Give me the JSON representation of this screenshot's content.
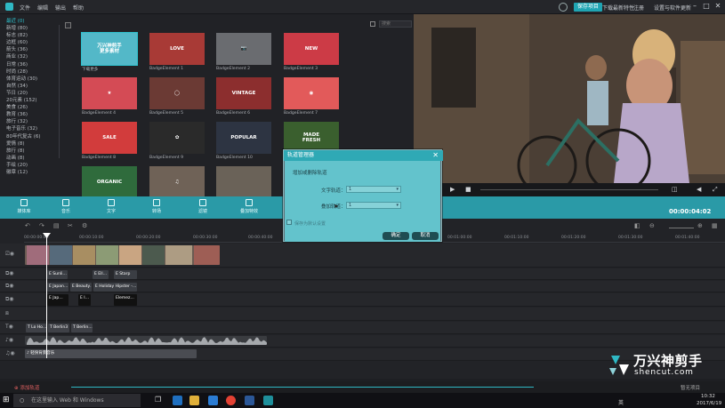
{
  "menu": {
    "items": [
      "文件",
      "编辑",
      "输出",
      "帮助"
    ]
  },
  "topbar": {
    "save_btn": "保存项目",
    "link1": "下载最新特性",
    "link2": "注册",
    "link3": "设置与软件更新"
  },
  "categories": [
    "最近 (0)",
    "新增 (80)",
    "标志 (82)",
    "边框 (60)",
    "箭头 (36)",
    "商业 (32)",
    "日常 (36)",
    "时尚 (28)",
    "体育运动 (30)",
    "自然 (34)",
    "节日 (20)",
    "20元素 (152)",
    "美食 (26)",
    "教育 (36)",
    "旅行 (32)",
    "电子音乐 (32)",
    "80年代复古 (6)",
    "爱情 (8)",
    "旅行 (8)",
    "动画 (8)",
    "手绘 (20)",
    "徽章 (12)"
  ],
  "search": {
    "placeholder": "搜索"
  },
  "elements": [
    {
      "label": "下载更多",
      "badge": "万兴神剪手\n更多素材",
      "color": "#53b8c8"
    },
    {
      "label": "BadgeElement 1",
      "badge": "LOVE",
      "color": "#a83a36"
    },
    {
      "label": "BadgeElement 2",
      "badge": "📷",
      "color": "#6a6c70"
    },
    {
      "label": "BadgeElement 3",
      "badge": "NEW",
      "color": "#cc3b46"
    },
    {
      "label": "BadgeElement 4",
      "badge": "★",
      "color": "#d44b55"
    },
    {
      "label": "BadgeElement 5",
      "badge": "◯",
      "color": "#6b3a34"
    },
    {
      "label": "BadgeElement 6",
      "badge": "VINTAGE",
      "color": "#8c2e2e"
    },
    {
      "label": "BadgeElement 7",
      "badge": "◉",
      "color": "#e25a5a"
    },
    {
      "label": "BadgeElement 8",
      "badge": "SALE",
      "color": "#d23c3c"
    },
    {
      "label": "BadgeElement 9",
      "badge": "✿",
      "color": "#2a2a2a"
    },
    {
      "label": "BadgeElement 10",
      "badge": "POPULAR",
      "color": "#2d3442"
    },
    {
      "label": "BadgeElement 11",
      "badge": "MADE\nFRESH",
      "color": "#3a5f2e"
    },
    {
      "label": "BadgeElement 12",
      "badge": "ORGANIC",
      "color": "#2f6b3c"
    },
    {
      "label": "BadgeElement 13",
      "badge": "♫",
      "color": "#6f6257"
    },
    {
      "label": "BadgeElement 14",
      "badge": "",
      "color": "#6a6258"
    },
    {
      "label": "BadgeElement 15",
      "badge": "",
      "color": "#5b6160"
    }
  ],
  "dialog": {
    "title": "轨道管理器",
    "text": "增加或删除轨道",
    "text_track_label": "文字轨道：",
    "text_track_value": "1",
    "overlay_track_label": "叠加轨道：",
    "overlay_track_value": "1",
    "checkbox_label": "保存为默认设置",
    "ok": "确定",
    "cancel": "取消"
  },
  "toolbar": {
    "tools": [
      "媒体库",
      "音乐",
      "文字",
      "转场",
      "滤镜",
      "叠加特效"
    ],
    "timecode": "00:00:04:02"
  },
  "ruler": {
    "ticks": [
      "00:00:00:00",
      "00:00:10:00",
      "00:00:20:00",
      "00:00:30:00",
      "00:00:40:00",
      "00:01:00:00",
      "00:01:10:00",
      "00:01:20:00",
      "00:01:30:00",
      "00:01:40:00"
    ]
  },
  "clips": {
    "el1": [
      "E Sunli…",
      "E Ell…",
      "E Starp"
    ],
    "el2": [
      "E Japan…",
      "E Beauty…",
      "E Holiday Hipster -…"
    ],
    "el3": [
      "E Jap…",
      "E I…",
      "Elemez…"
    ],
    "text": [
      "T Lo Ho…",
      "T Berlin3",
      "T Berlin…"
    ],
    "music": "♪ 轻快背景音乐"
  },
  "watermark": {
    "brand": "万兴神剪手",
    "url": "shencut.com"
  },
  "status": {
    "add_track": "⊕ 添加轨道",
    "project": "暂无项目"
  },
  "taskbar": {
    "search": "在这里输入 Web 和 Windows",
    "time": "10:32",
    "date": "2017/6/19",
    "lang": "英"
  },
  "colors": {
    "accent": "#2fb8c4",
    "toolbar": "#2a9aa7",
    "dialog": "#63c3cc"
  }
}
